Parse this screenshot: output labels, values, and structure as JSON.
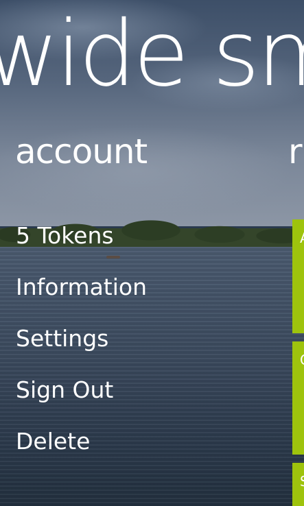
{
  "app": {
    "title": "wide sm"
  },
  "pivot": {
    "headers": [
      {
        "label": "account"
      },
      {
        "label": "r"
      }
    ]
  },
  "account_menu": {
    "items": [
      {
        "label": "5 Tokens"
      },
      {
        "label": "Information"
      },
      {
        "label": "Settings"
      },
      {
        "label": "Sign Out"
      },
      {
        "label": "Delete"
      }
    ]
  },
  "tiles": [
    {
      "letter": "A",
      "color": "#9ec30d"
    },
    {
      "letter": "C",
      "color": "#9ec30d"
    },
    {
      "letter": "S",
      "color": "#9ec30d"
    }
  ],
  "theme": {
    "accent": "#9ec30d",
    "text": "#ffffff"
  }
}
